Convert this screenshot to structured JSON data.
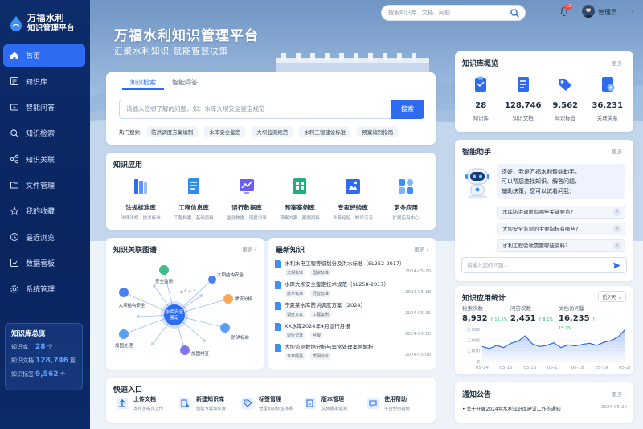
{
  "brand": {
    "name": "万福水利",
    "subtitle": "知识管理平台"
  },
  "nav": [
    {
      "label": "首页",
      "icon": "home-icon",
      "active": true
    },
    {
      "label": "知识库",
      "icon": "book-icon"
    },
    {
      "label": "智能问答",
      "icon": "chat-icon"
    },
    {
      "label": "知识检索",
      "icon": "search-icon"
    },
    {
      "label": "知识关联",
      "icon": "share-icon"
    },
    {
      "label": "文件管理",
      "icon": "folder-icon"
    },
    {
      "label": "我的收藏",
      "icon": "star-icon"
    },
    {
      "label": "最近浏览",
      "icon": "clock-icon"
    },
    {
      "label": "数据看板",
      "icon": "dashboard-icon"
    },
    {
      "label": "系统管理",
      "icon": "gear-icon"
    }
  ],
  "kb_summary": {
    "title": "知识库总览",
    "rows": [
      {
        "label": "知识库",
        "value": "28",
        "unit": "个"
      },
      {
        "label": "知识文档",
        "value": "128,746",
        "unit": "篇"
      },
      {
        "label": "知识标签",
        "value": "9,562",
        "unit": "个"
      }
    ]
  },
  "topbar": {
    "search_placeholder": "搜索知识库、文档、问题...",
    "badge": "12",
    "user": "管理员"
  },
  "hero": {
    "title": "万福水利知识管理平台",
    "subtitle": "汇聚水利知识  赋能智慧决策"
  },
  "search": {
    "tabs": [
      "知识检索",
      "智能问答"
    ],
    "placeholder": "请输入您想了解的问题，如：水库大坝安全鉴定规范",
    "button": "搜索",
    "hot_label": "热门搜索:",
    "hot": [
      "防洪调度方案编制",
      "水库安全鉴定",
      "大坝监测规范",
      "水利工程建设标准",
      "预案编制指南"
    ]
  },
  "apps": {
    "title": "知识应用",
    "items": [
      {
        "name": "法规标准库",
        "desc": "法律法规、技术标准",
        "color": "#2d6bf0"
      },
      {
        "name": "工程信息库",
        "desc": "工程档案、基础资料",
        "color": "#2d8cf0"
      },
      {
        "name": "运行数据库",
        "desc": "监测数据、调度记录",
        "color": "#6b5ef0"
      },
      {
        "name": "预案案例库",
        "desc": "预案方案、案例资料",
        "color": "#22b07a"
      },
      {
        "name": "专家经验库",
        "desc": "业务经验、知识沉淀",
        "color": "#2d6bf0"
      },
      {
        "name": "更多应用",
        "desc": "扩展应用中心",
        "color": "#3d8ef5"
      }
    ]
  },
  "graph": {
    "title": "知识关联图谱",
    "more": "更多",
    "center": [
      "水库安全",
      "鉴定"
    ],
    "nodes": [
      "安全监测",
      "大坝结构安全",
      "渗流分析",
      "防洪标准",
      "加固排查",
      "加固处理",
      "大坝结构安全"
    ],
    "mini": "▲ 6 ◎ 3"
  },
  "news": {
    "title": "最新知识",
    "more": "更多",
    "items": [
      {
        "title": "水利水电工程等级划分及洪水标准（SL252-2017）",
        "tags": [
          "法规标准",
          "国家标准"
        ],
        "date": "2024-05-20"
      },
      {
        "title": "水库大坝安全鉴定技术规范（SL258-2017）",
        "tags": [
          "技术标准",
          "行业标准"
        ],
        "date": "2024-05-18"
      },
      {
        "title": "宁夏某水库防洪调度方案（2024）",
        "tags": [
          "调度方案",
          "工程案例"
        ],
        "date": "2024-05-15"
      },
      {
        "title": "XX水库2024年4月运行月报",
        "tags": [
          "运行记录",
          "月报"
        ],
        "date": "2024-05-10"
      },
      {
        "title": "大坝监测数据分析与异常处理案例解析",
        "tags": [
          "专家经验",
          "案例分析"
        ],
        "date": "2024-05-08"
      }
    ]
  },
  "quick": {
    "title": "快速入口",
    "items": [
      {
        "name": "上传文档",
        "desc": "支持多格式上传"
      },
      {
        "name": "新建知识库",
        "desc": "创建专属知识库"
      },
      {
        "name": "标签管理",
        "desc": "管理知识标签体系"
      },
      {
        "name": "版本管理",
        "desc": "文档版本追溯"
      },
      {
        "name": "使用帮助",
        "desc": "平台使用指南"
      }
    ]
  },
  "overview": {
    "title": "知识库概览",
    "more": "更多",
    "items": [
      {
        "value": "28",
        "label": "知识库"
      },
      {
        "value": "128,746",
        "label": "知识文档"
      },
      {
        "value": "9,562",
        "label": "知识标签"
      },
      {
        "value": "36,231",
        "label": "关联关系"
      }
    ]
  },
  "assistant": {
    "title": "智能助手",
    "more": "更多",
    "greeting": [
      "您好，我是万福水利智能助手，",
      "可以帮您查找知识、解答问题、",
      "辅助决策，您可以试着问我："
    ],
    "questions": [
      "水库防洪调度有哪些关键要点?",
      "大坝安全监测的主要指标有哪些?",
      "水利工程验收需要哪些资料?"
    ],
    "input_placeholder": "请输入您的问题..."
  },
  "stats": {
    "title": "知识应用统计",
    "select": "近7天 ⌄",
    "items": [
      {
        "label": "检索次数",
        "value": "8,932",
        "delta": "↑ 12.5%"
      },
      {
        "label": "问答次数",
        "value": "2,451",
        "delta": "↑ 8.1%"
      },
      {
        "label": "文档访问量",
        "value": "16,235",
        "delta": "↑ 15.7%"
      }
    ]
  },
  "chart_data": {
    "type": "area",
    "x": [
      "05-14",
      "05-15",
      "05-16",
      "05-17",
      "05-18",
      "05-19",
      "05-20"
    ],
    "values": [
      1400,
      1200,
      1500,
      1300,
      1700,
      1900,
      2400,
      1650,
      1400,
      1500,
      1750,
      1300,
      1550,
      1450,
      1600,
      1700,
      1500,
      1800,
      1950,
      2300,
      3000
    ],
    "yticks": [
      "3,000",
      "2,000",
      "1,000",
      "0"
    ],
    "ylim": [
      0,
      3000
    ],
    "color": "#2d6bf0"
  },
  "notice": {
    "title": "通知公告",
    "more": "更多",
    "item": {
      "text": "关于开展2024年水利知识库建设工作的通知",
      "date": "2024-05-20"
    }
  }
}
